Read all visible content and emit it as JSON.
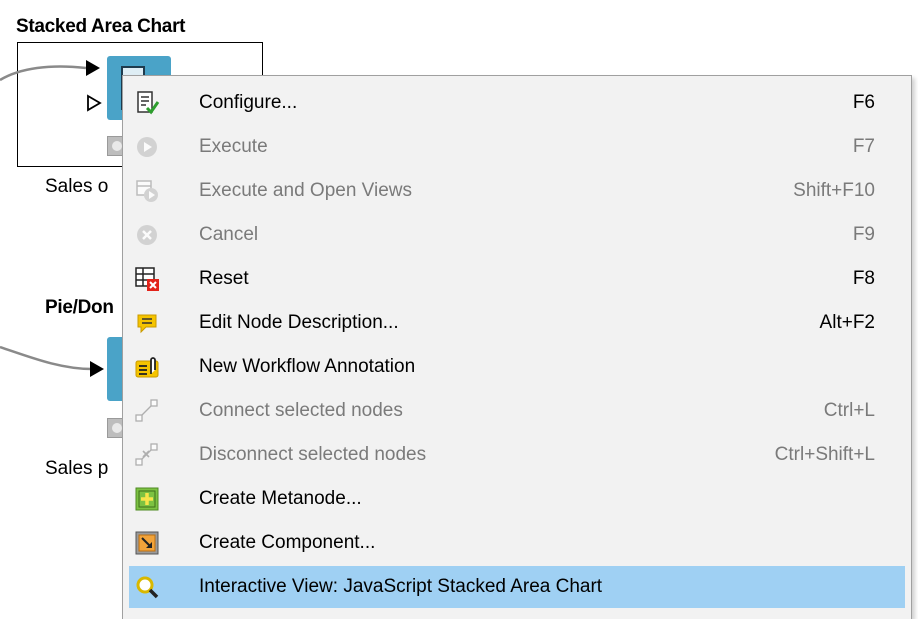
{
  "canvas": {
    "node1": {
      "title": "Stacked Area Chart",
      "label": "Sales o"
    },
    "node2": {
      "title": "Pie/Don",
      "label": "Sales p"
    }
  },
  "menu": {
    "items": [
      {
        "label": "Configure...",
        "shortcut": "F6",
        "enabled": true,
        "icon": "configure-icon"
      },
      {
        "label": "Execute",
        "shortcut": "F7",
        "enabled": false,
        "icon": "execute-icon"
      },
      {
        "label": "Execute and Open Views",
        "shortcut": "Shift+F10",
        "enabled": false,
        "icon": "execute-open-views-icon"
      },
      {
        "label": "Cancel",
        "shortcut": "F9",
        "enabled": false,
        "icon": "cancel-icon"
      },
      {
        "label": "Reset",
        "shortcut": "F8",
        "enabled": true,
        "icon": "reset-icon"
      },
      {
        "label": "Edit Node Description...",
        "shortcut": "Alt+F2",
        "enabled": true,
        "icon": "edit-description-icon"
      },
      {
        "label": "New Workflow Annotation",
        "shortcut": "",
        "enabled": true,
        "icon": "annotation-icon"
      },
      {
        "label": "Connect selected nodes",
        "shortcut": "Ctrl+L",
        "enabled": false,
        "icon": "connect-nodes-icon"
      },
      {
        "label": "Disconnect selected nodes",
        "shortcut": "Ctrl+Shift+L",
        "enabled": false,
        "icon": "disconnect-nodes-icon"
      },
      {
        "label": "Create Metanode...",
        "shortcut": "",
        "enabled": true,
        "icon": "metanode-icon"
      },
      {
        "label": "Create Component...",
        "shortcut": "",
        "enabled": true,
        "icon": "component-icon"
      },
      {
        "label": "Interactive View: JavaScript Stacked Area Chart",
        "shortcut": "",
        "enabled": true,
        "icon": "interactive-view-icon",
        "highlighted": true
      }
    ]
  },
  "colors": {
    "node": "#4aa3c8",
    "highlight": "#9fd0f3",
    "menu_bg": "#f2f2f2",
    "disabled_text": "#7a7a7a"
  }
}
